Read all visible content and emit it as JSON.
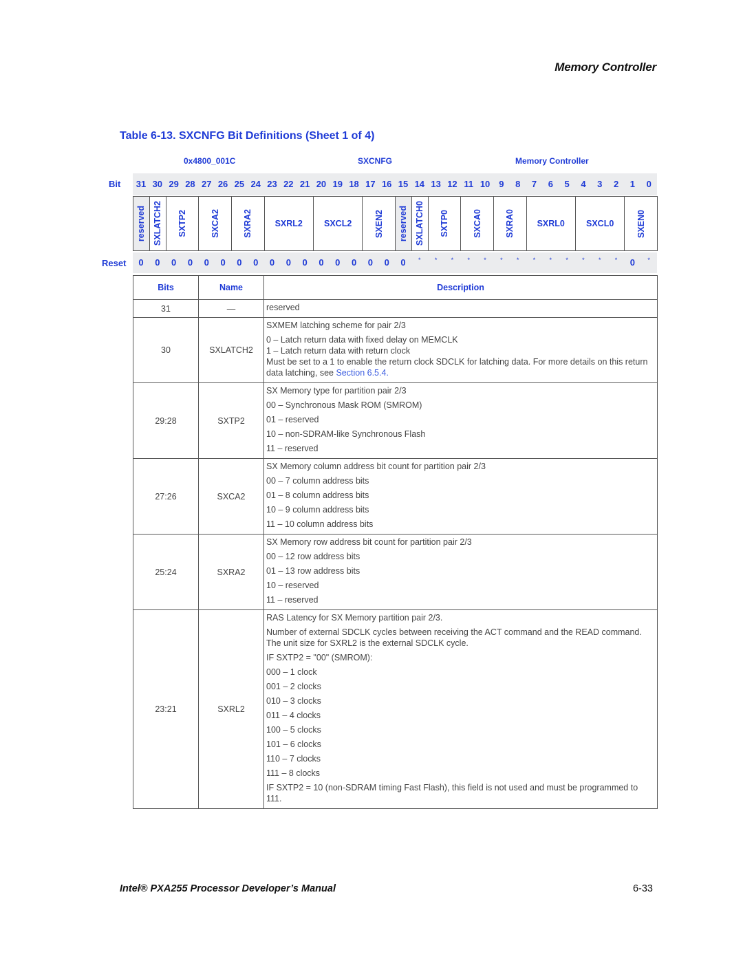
{
  "header": {
    "section_title": "Memory Controller"
  },
  "caption": "Table 6-13. SXCNFG Bit Definitions (Sheet 1 of 4)",
  "register": {
    "address": "0x4800_001C",
    "name": "SXCNFG",
    "unit": "Memory Controller",
    "bit_label": "Bit",
    "reset_label": "Reset",
    "bits": [
      "31",
      "30",
      "29",
      "28",
      "27",
      "26",
      "25",
      "24",
      "23",
      "22",
      "21",
      "20",
      "19",
      "18",
      "17",
      "16",
      "15",
      "14",
      "13",
      "12",
      "11",
      "10",
      "9",
      "8",
      "7",
      "6",
      "5",
      "4",
      "3",
      "2",
      "1",
      "0"
    ],
    "reset_values": [
      "0",
      "0",
      "0",
      "0",
      "0",
      "0",
      "0",
      "0",
      "0",
      "0",
      "0",
      "0",
      "0",
      "0",
      "0",
      "0",
      "0",
      "*",
      "*",
      "*",
      "*",
      "*",
      "*",
      "*",
      "*",
      "*",
      "*",
      "*",
      "*",
      "*",
      "0",
      "*"
    ],
    "fields": [
      {
        "name": "reserved",
        "msb": 31,
        "lsb": 31,
        "vertical": true,
        "reserved": true
      },
      {
        "name": "SXLATCH2",
        "msb": 30,
        "lsb": 30,
        "vertical": true,
        "reserved": false
      },
      {
        "name": "SXTP2",
        "msb": 29,
        "lsb": 28,
        "vertical": true,
        "reserved": false
      },
      {
        "name": "SXCA2",
        "msb": 27,
        "lsb": 26,
        "vertical": true,
        "reserved": false
      },
      {
        "name": "SXRA2",
        "msb": 25,
        "lsb": 24,
        "vertical": true,
        "reserved": false
      },
      {
        "name": "SXRL2",
        "msb": 23,
        "lsb": 21,
        "vertical": false,
        "reserved": false
      },
      {
        "name": "SXCL2",
        "msb": 20,
        "lsb": 18,
        "vertical": false,
        "reserved": false
      },
      {
        "name": "SXEN2",
        "msb": 17,
        "lsb": 16,
        "vertical": true,
        "reserved": false
      },
      {
        "name": "reserved",
        "msb": 15,
        "lsb": 15,
        "vertical": true,
        "reserved": true
      },
      {
        "name": "SXLATCH0",
        "msb": 14,
        "lsb": 14,
        "vertical": true,
        "reserved": false
      },
      {
        "name": "SXTP0",
        "msb": 13,
        "lsb": 12,
        "vertical": true,
        "reserved": false
      },
      {
        "name": "SXCA0",
        "msb": 11,
        "lsb": 10,
        "vertical": true,
        "reserved": false
      },
      {
        "name": "SXRA0",
        "msb": 9,
        "lsb": 8,
        "vertical": true,
        "reserved": false
      },
      {
        "name": "SXRL0",
        "msb": 7,
        "lsb": 5,
        "vertical": false,
        "reserved": false
      },
      {
        "name": "SXCL0",
        "msb": 4,
        "lsb": 2,
        "vertical": false,
        "reserved": false
      },
      {
        "name": "SXEN0",
        "msb": 1,
        "lsb": 0,
        "vertical": true,
        "reserved": false
      }
    ]
  },
  "table": {
    "headers": {
      "bits": "Bits",
      "name": "Name",
      "description": "Description"
    },
    "rows": [
      {
        "bits": "31",
        "name": "—",
        "desc": [
          "reserved"
        ]
      },
      {
        "bits": "30",
        "name": "SXLATCH2",
        "desc": [
          "SXMEM latching scheme for pair 2/3",
          "0 –  Latch return data with fixed delay on MEMCLK",
          "1 –  Latch return data with return clock",
          "Must be set to a 1 to enable the return clock SDCLK for latching data. For more details on this return data latching, see "
        ],
        "link": "Section 6.5.4",
        "link_suffix": "."
      },
      {
        "bits": "29:28",
        "name": "SXTP2",
        "desc": [
          "SX Memory type for partition pair 2/3",
          "00 – Synchronous Mask ROM (SMROM)",
          "01 – reserved",
          "10 – non-SDRAM-like Synchronous Flash",
          "11 – reserved"
        ]
      },
      {
        "bits": "27:26",
        "name": "SXCA2",
        "desc": [
          "SX Memory column address bit count for partition pair 2/3",
          "00 – 7 column address bits",
          "01 – 8 column address bits",
          "10 – 9 column address bits",
          "11 – 10 column address bits"
        ]
      },
      {
        "bits": "25:24",
        "name": "SXRA2",
        "desc": [
          "SX Memory row address bit count for partition pair 2/3",
          "00 – 12 row address bits",
          "01 – 13 row address bits",
          "10 – reserved",
          "11 – reserved"
        ]
      },
      {
        "bits": "23:21",
        "name": "SXRL2",
        "desc": [
          "RAS Latency for SX Memory partition pair 2/3.",
          "Number of external SDCLK cycles between receiving the ACT command and the READ command. The unit size for SXRL2 is the external SDCLK cycle.",
          "IF SXTP2 = \"00\" (SMROM):",
          "000 – 1 clock",
          "001 – 2 clocks",
          "010 – 3 clocks",
          "011 – 4 clocks",
          "100 – 5 clocks",
          "101 – 6 clocks",
          "110 – 7 clocks",
          "111 – 8 clocks",
          "IF SXTP2 = 10 (non-SDRAM timing Fast Flash), this field is not used and must be programmed to 111."
        ]
      }
    ]
  },
  "footer": {
    "manual_title": "Intel® PXA255 Processor Developer’s Manual",
    "page_number": "6-33"
  }
}
